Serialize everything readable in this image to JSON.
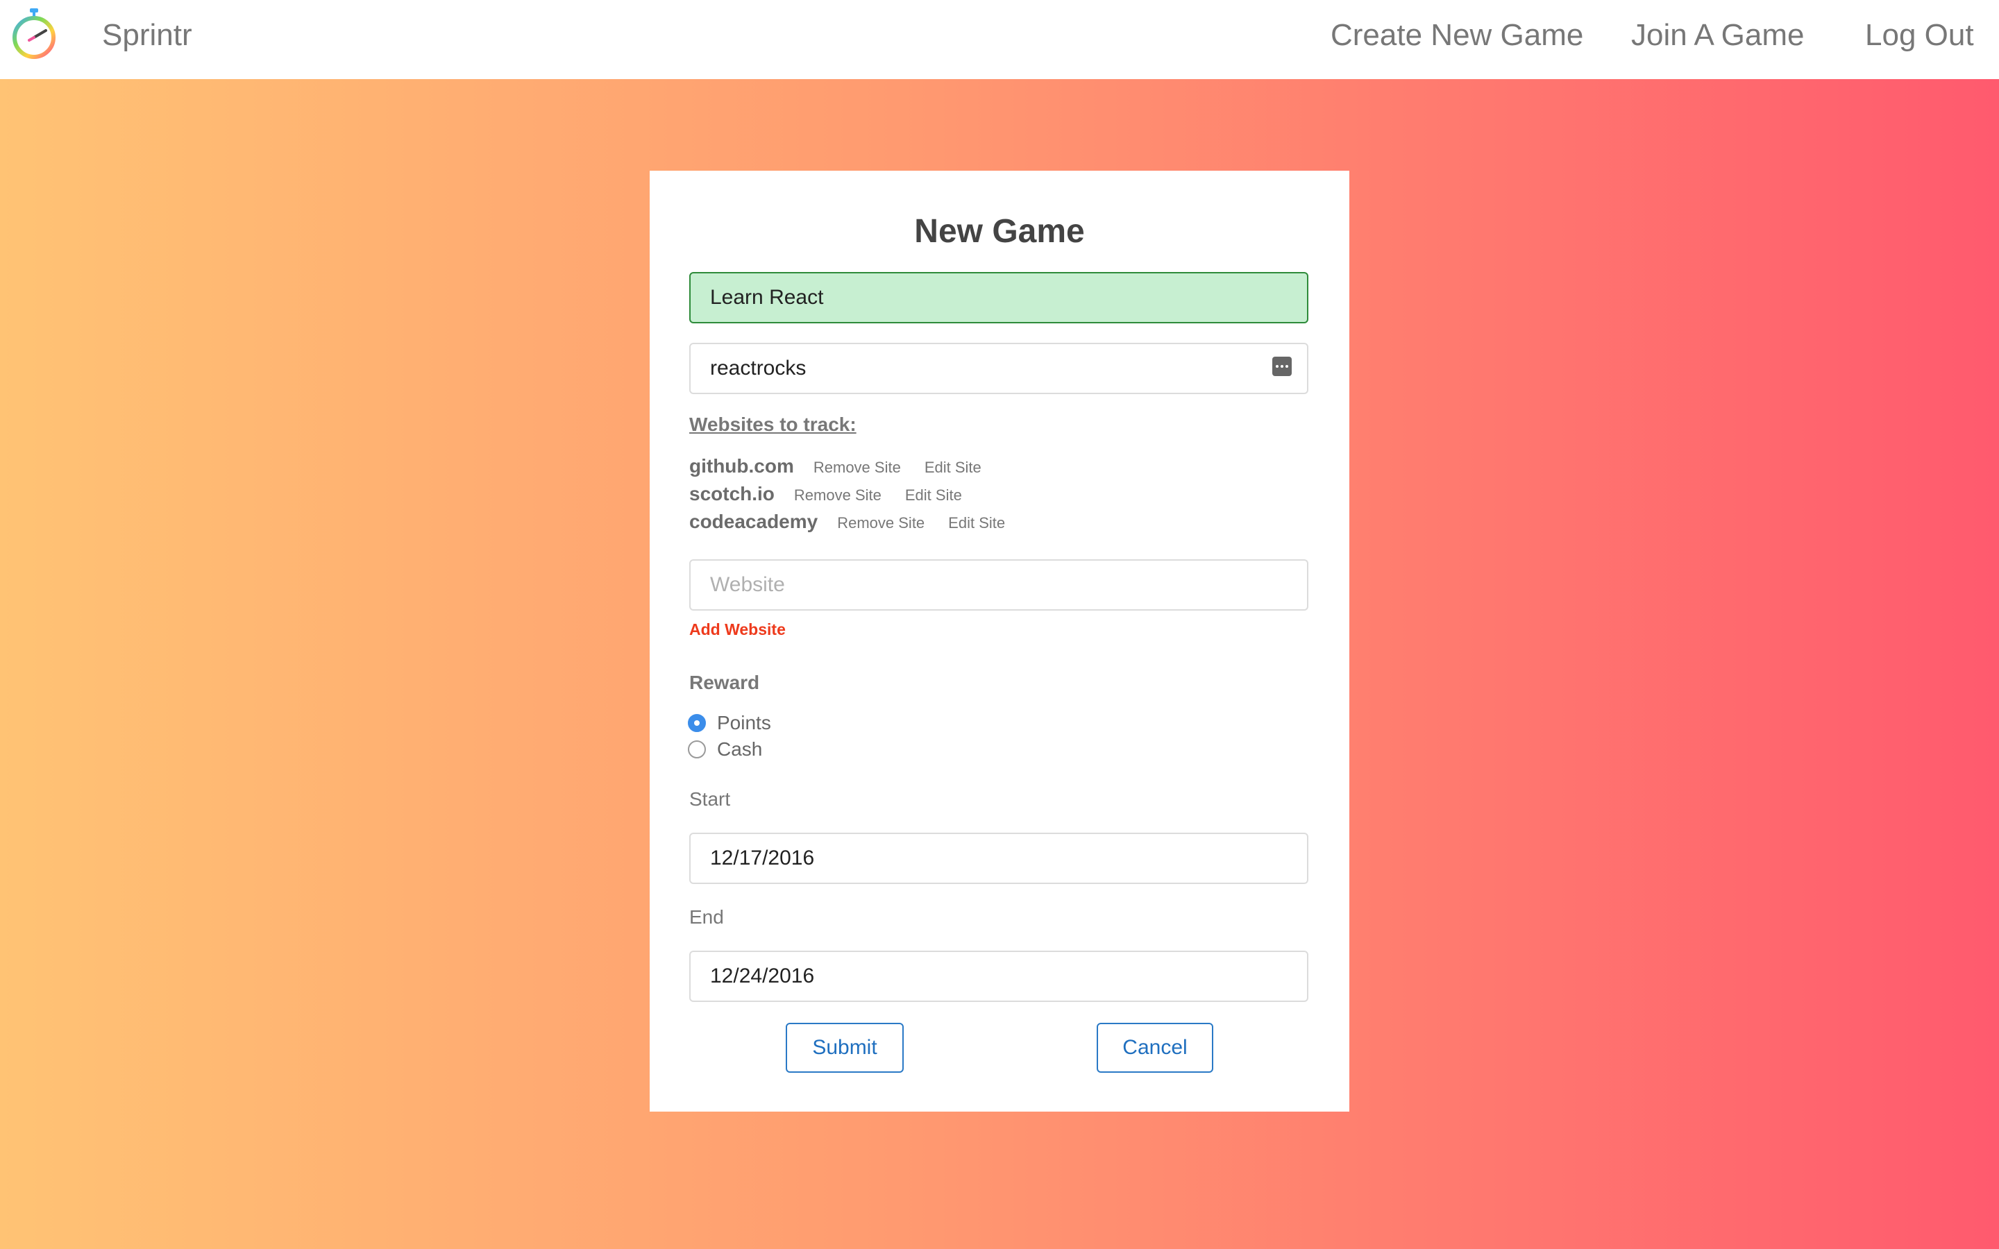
{
  "navbar": {
    "brand": "Sprintr",
    "links": [
      "Create New Game",
      "Join A Game",
      "Log Out"
    ]
  },
  "icons": {
    "logo": "stopwatch-icon",
    "password_toggle": "password-dots-icon"
  },
  "form": {
    "title": "New Game",
    "game_name_value": "Learn React",
    "password_value": "reactrocks",
    "websites_label": "Websites to track:",
    "sites": [
      {
        "name": "github.com",
        "remove": "Remove Site",
        "edit": "Edit Site"
      },
      {
        "name": "scotch.io",
        "remove": "Remove Site",
        "edit": "Edit Site"
      },
      {
        "name": "codeacademy",
        "remove": "Remove Site",
        "edit": "Edit Site"
      }
    ],
    "website_placeholder": "Website",
    "add_website": "Add Website",
    "reward_label": "Reward",
    "reward_options": [
      "Points",
      "Cash"
    ],
    "reward_selected": "Points",
    "start_label": "Start",
    "start_value": "12/17/2016",
    "end_label": "End",
    "end_value": "12/24/2016",
    "submit": "Submit",
    "cancel": "Cancel"
  },
  "colors": {
    "gradient_start": "#ffc374",
    "gradient_end": "#ff5a6e",
    "accent_blue": "#1f6fbf",
    "add_website_red": "#ee3a1c",
    "valid_green_bg": "#c7efd1"
  }
}
